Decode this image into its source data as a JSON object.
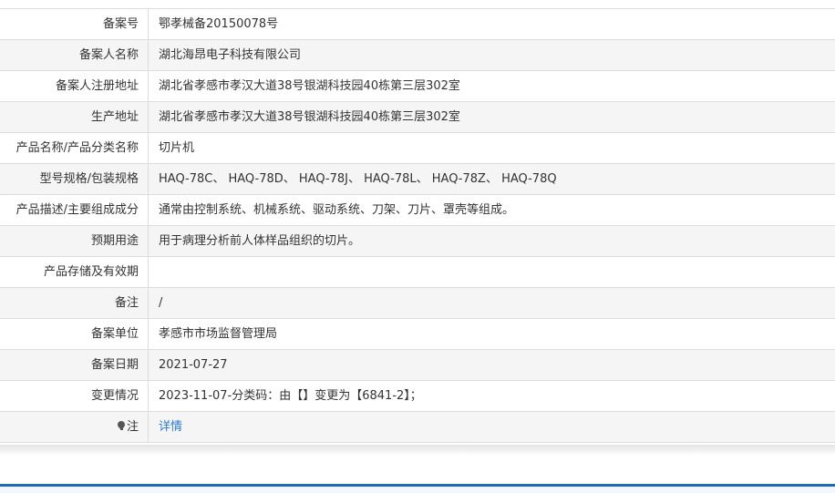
{
  "rows": [
    {
      "label": "备案号",
      "value": "鄂孝械备20150078号"
    },
    {
      "label": "备案人名称",
      "value": "湖北海昂电子科技有限公司"
    },
    {
      "label": "备案人注册地址",
      "value": "湖北省孝感市孝汉大道38号银湖科技园40栋第三层302室"
    },
    {
      "label": "生产地址",
      "value": "湖北省孝感市孝汉大道38号银湖科技园40栋第三层302室"
    },
    {
      "label": "产品名称/产品分类名称",
      "value": "切片机"
    },
    {
      "label": "型号规格/包装规格",
      "value": "HAQ-78C、 HAQ-78D、 HAQ-78J、 HAQ-78L、 HAQ-78Z、 HAQ-78Q"
    },
    {
      "label": "产品描述/主要组成成分",
      "value": "通常由控制系统、机械系统、驱动系统、刀架、刀片、罩壳等组成。"
    },
    {
      "label": "预期用途",
      "value": "用于病理分析前人体样品组织的切片。"
    },
    {
      "label": "产品存储及有效期",
      "value": ""
    },
    {
      "label": "备注",
      "value": "/"
    },
    {
      "label": "备案单位",
      "value": "孝感市市场监督管理局"
    },
    {
      "label": "备案日期",
      "value": "2021-07-27"
    },
    {
      "label": "变更情况",
      "value": "2023-11-07-分类码：由【】变更为【6841-2】；"
    }
  ],
  "note_row": {
    "icon": "bulb-icon",
    "label": "注",
    "link": "详情"
  },
  "colors": {
    "link": "#2a7ad5",
    "accent_bar": "#1d6bb5",
    "border": "#dddddd",
    "alt_row": "#f5f5f5"
  }
}
